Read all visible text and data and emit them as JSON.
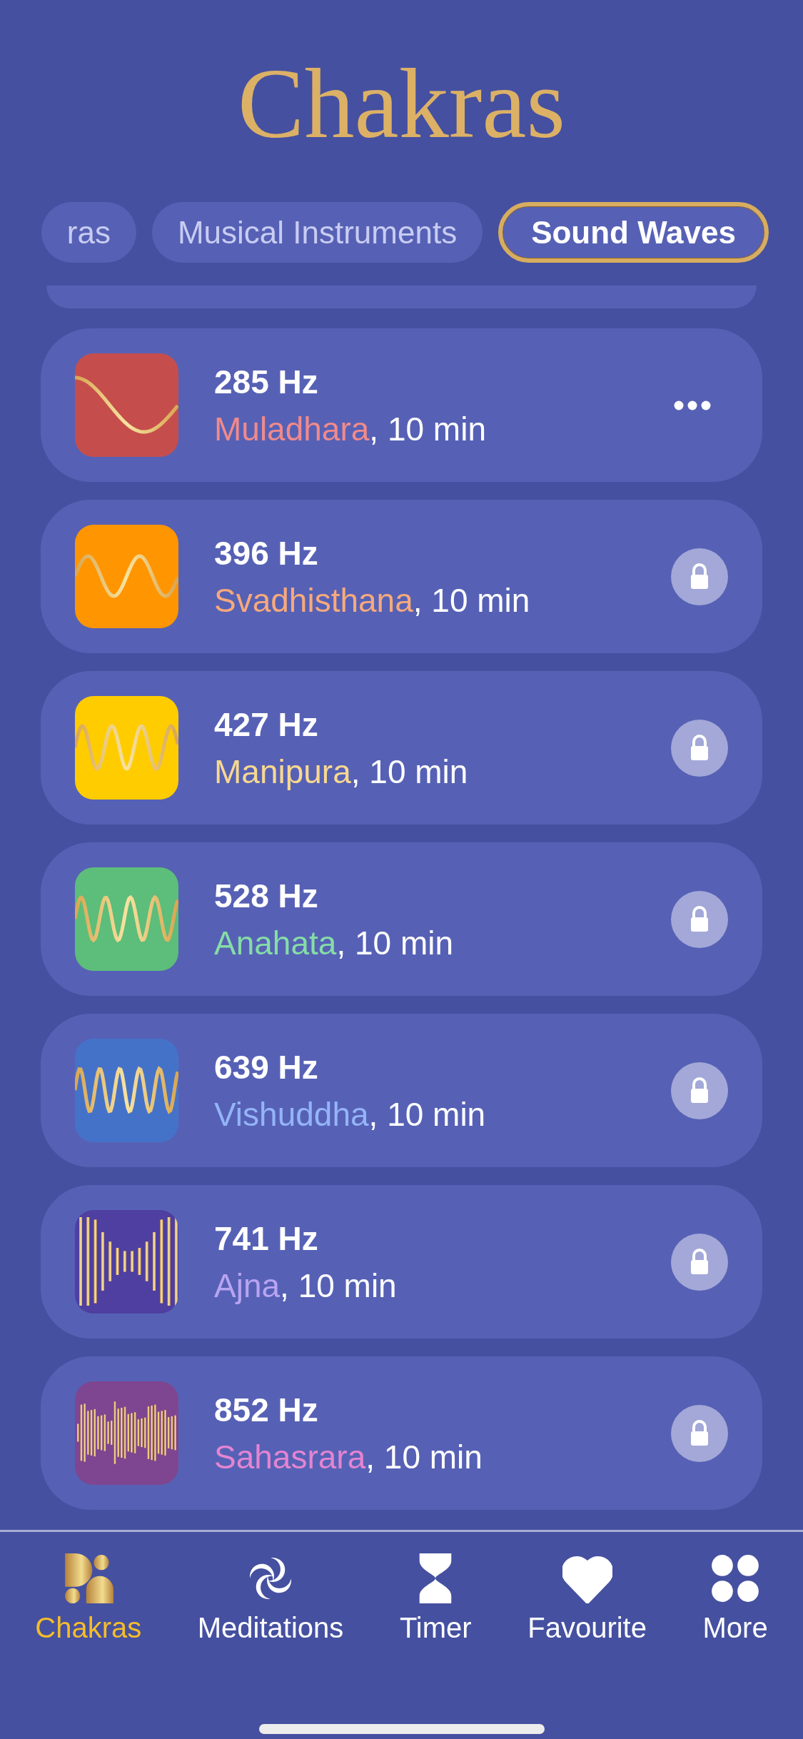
{
  "title": "Chakras",
  "tabs": [
    {
      "label": "ras",
      "selected": false
    },
    {
      "label": "Musical Instruments",
      "selected": false
    },
    {
      "label": "Sound Waves",
      "selected": true
    }
  ],
  "tracks": [
    {
      "frequency": "285 Hz",
      "chakra": "Muladhara",
      "color": "#f08a8c",
      "duration": ", 10 min",
      "kind": "menu"
    },
    {
      "frequency": "396 Hz",
      "chakra": "Svadhisthana",
      "color": "#f7a97c",
      "duration": ", 10 min",
      "kind": "locked"
    },
    {
      "frequency": "427 Hz",
      "chakra": "Manipura",
      "color": "#f8d890",
      "duration": ", 10 min",
      "kind": "locked"
    },
    {
      "frequency": "528 Hz",
      "chakra": "Anahata",
      "color": "#86dca6",
      "duration": ", 10 min",
      "kind": "locked"
    },
    {
      "frequency": "639 Hz",
      "chakra": "Vishuddha",
      "color": "#94b4f8",
      "duration": ", 10 min",
      "kind": "locked"
    },
    {
      "frequency": "741 Hz",
      "chakra": "Ajna",
      "color": "#b9a4f2",
      "duration": ", 10 min",
      "kind": "locked"
    },
    {
      "frequency": "852 Hz",
      "chakra": "Sahasrara",
      "color": "#e385d2",
      "duration": ", 10 min",
      "kind": "locked"
    }
  ],
  "nav": [
    {
      "label": "Chakras",
      "selected": true
    },
    {
      "label": "Meditations",
      "selected": false
    },
    {
      "label": "Timer",
      "selected": false
    },
    {
      "label": "Favourite",
      "selected": false
    },
    {
      "label": "More",
      "selected": false
    }
  ]
}
